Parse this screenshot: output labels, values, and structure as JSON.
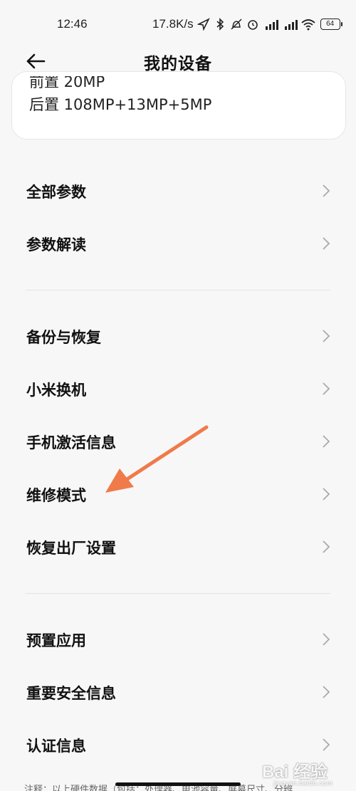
{
  "status_bar": {
    "time": "12:46",
    "speed": "17.8K/s",
    "battery": "64"
  },
  "header": {
    "title": "我的设备"
  },
  "card": {
    "front_camera": "前置 20MP",
    "rear_camera": "后置 108MP+13MP+5MP"
  },
  "menu": {
    "group1": [
      {
        "label": "全部参数"
      },
      {
        "label": "参数解读"
      }
    ],
    "group2": [
      {
        "label": "备份与恢复"
      },
      {
        "label": "小米换机"
      },
      {
        "label": "手机激活信息"
      },
      {
        "label": "维修模式"
      },
      {
        "label": "恢复出厂设置"
      }
    ],
    "group3": [
      {
        "label": "预置应用"
      },
      {
        "label": "重要安全信息"
      },
      {
        "label": "认证信息"
      }
    ]
  },
  "footer": {
    "note": "注释：以上硬件数据（包括：处理器、电池容量、屏幕尺寸、分辨"
  },
  "watermark": {
    "brand": "Bai 经验",
    "url": "jingyan.baidu.com"
  },
  "colors": {
    "arrow": "#f07a4a",
    "background": "#f7f7f7"
  }
}
